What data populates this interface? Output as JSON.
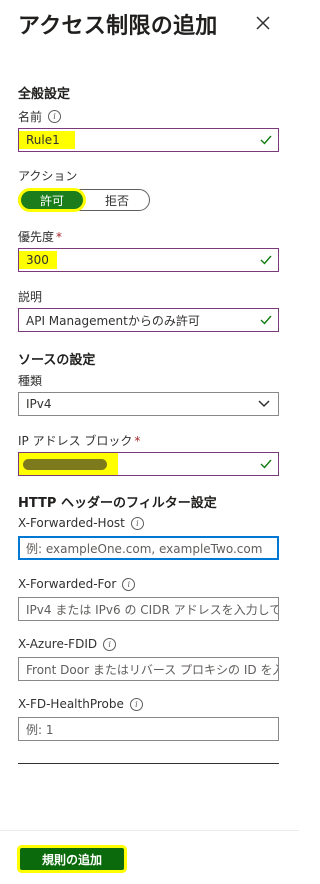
{
  "header": {
    "title": "アクセス制限の追加",
    "close_icon": "close-icon"
  },
  "general": {
    "heading": "全般設定",
    "name": {
      "label": "名前",
      "value": "Rule1"
    },
    "action": {
      "label": "アクション",
      "allow": "許可",
      "deny": "拒否",
      "selected": "許可"
    },
    "priority": {
      "label": "優先度",
      "required": "*",
      "value": "300"
    },
    "description": {
      "label": "説明",
      "value": "API Managementからのみ許可"
    }
  },
  "source": {
    "heading": "ソースの設定",
    "type": {
      "label": "種類",
      "value": "IPv4"
    },
    "ip_block": {
      "label": "IP アドレス ブロック",
      "required": "*",
      "value": ""
    }
  },
  "http_headers": {
    "heading": "HTTP ヘッダーのフィルター設定",
    "forwarded_host": {
      "label": "X-Forwarded-Host",
      "placeholder": "例: exampleOne.com, exampleTwo.com"
    },
    "forwarded_for": {
      "label": "X-Forwarded-For",
      "placeholder": "IPv4 または IPv6 の CIDR アドレスを入力して..."
    },
    "azure_fdid": {
      "label": "X-Azure-FDID",
      "placeholder": "Front Door またはリバース プロキシの ID を入..."
    },
    "fd_healthprobe": {
      "label": "X-FD-HealthProbe",
      "placeholder": "例: 1"
    }
  },
  "footer": {
    "add_button": "規則の追加"
  },
  "colors": {
    "valid_check": "#107c10",
    "toggle_on": "#1b7d1b",
    "add_button": "#0b6a0b",
    "highlight": "#ffff00",
    "focus_border": "#0078d4"
  }
}
